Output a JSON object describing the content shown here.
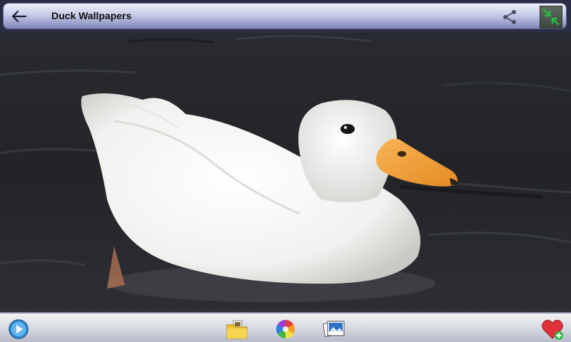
{
  "app": {
    "title": "Duck Wallpapers"
  },
  "toolbar": {
    "back_icon": "arrow-left-icon",
    "share_icon": "share-icon",
    "fullscreen_icon": "collapse-arrows-icon"
  },
  "bottom_bar": {
    "items": [
      {
        "name": "slideshow",
        "icon": "play-icon"
      },
      {
        "name": "folder",
        "icon": "folder-icon"
      },
      {
        "name": "color-filter",
        "icon": "color-wheel-icon"
      },
      {
        "name": "gallery",
        "icon": "photo-stack-icon"
      },
      {
        "name": "add-favorite",
        "icon": "heart-plus-icon"
      }
    ]
  },
  "colors": {
    "water": "#26282d",
    "duck": "#f5f5f3",
    "beak": "#f2a23a",
    "accent_green": "#2fb84a",
    "heart_red": "#e0323a"
  }
}
